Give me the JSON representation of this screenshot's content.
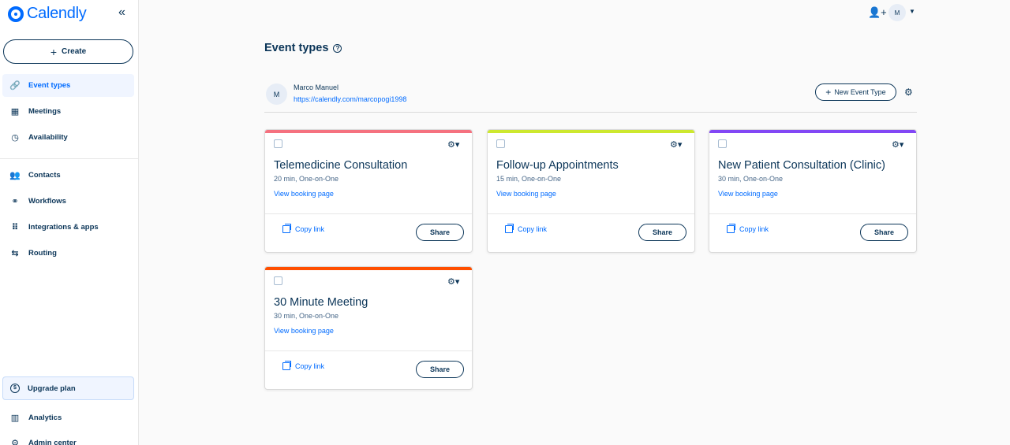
{
  "sidebar": {
    "brand": "Calendly",
    "collapse_icon": "«",
    "create_label": "Create",
    "nav_top": [
      {
        "label": "Event types",
        "icon": "🔗",
        "active": true
      },
      {
        "label": "Meetings",
        "icon": "▦"
      },
      {
        "label": "Availability",
        "icon": "◷"
      }
    ],
    "nav_mid": [
      {
        "label": "Contacts",
        "icon": "👥"
      },
      {
        "label": "Workflows",
        "icon": "⚭"
      },
      {
        "label": "Integrations & apps",
        "icon": "⠿"
      },
      {
        "label": "Routing",
        "icon": "⇆"
      }
    ],
    "upgrade_label": "Upgrade plan",
    "upgrade_icon": "$",
    "nav_bottom": [
      {
        "label": "Analytics",
        "icon": "▥"
      },
      {
        "label": "Admin center",
        "icon": "⚙"
      }
    ]
  },
  "header": {
    "avatar_initial": "M",
    "add_user_icon": "👤+"
  },
  "main": {
    "title": "Event types",
    "help_icon": "?",
    "owner": {
      "initial": "M",
      "name": "Marco Manuel",
      "link": "https://calendly.com/marcopogi1998"
    },
    "new_event_label": "New Event Type",
    "cards": [
      {
        "title": "Telemedicine Consultation",
        "subtitle": "20 min, One-on-One",
        "color": "#f5717f"
      },
      {
        "title": "Follow-up Appointments",
        "subtitle": "15 min, One-on-One",
        "color": "#cde82f"
      },
      {
        "title": "New Patient Consultation (Clinic)",
        "subtitle": "30 min, One-on-One",
        "color": "#8247f5"
      },
      {
        "title": "30 Minute Meeting",
        "subtitle": "30 min, One-on-One",
        "color": "#ff4f00"
      }
    ],
    "view_booking_label": "View booking page",
    "copy_link_label": "Copy link",
    "share_label": "Share"
  }
}
